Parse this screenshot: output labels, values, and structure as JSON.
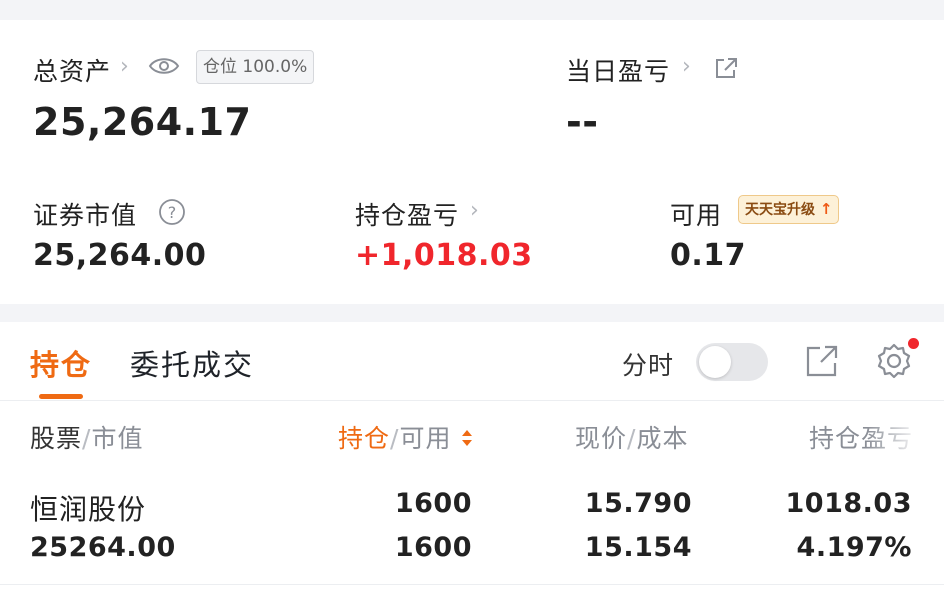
{
  "summary": {
    "total_assets_label": "总资产",
    "position_badge": "仓位 100.0%",
    "total_assets_value": "25,264.17",
    "daily_pnl_label": "当日盈亏",
    "daily_pnl_value": "--",
    "market_value_label": "证券市值",
    "market_value_value": "25,264.00",
    "holding_pnl_label": "持仓盈亏",
    "holding_pnl_value": "+1,018.03",
    "available_label": "可用",
    "available_value": "0.17",
    "promo_label": "天天宝升级"
  },
  "tabs": {
    "holdings": "持仓",
    "orders": "委托成交"
  },
  "toolbar": {
    "timeshare_label": "分时",
    "timeshare_on": false
  },
  "table": {
    "col1_a": "股票",
    "col1_b": "市值",
    "col2_a": "持仓",
    "col2_b": "可用",
    "col3_a": "现价",
    "col3_b": "成本",
    "col4": "持仓盈亏",
    "separator": "/",
    "rows": [
      {
        "name": "恒润股份",
        "market_value": "25264.00",
        "position": "1600",
        "available": "1600",
        "price": "15.790",
        "cost": "15.154",
        "pnl": "1018.03",
        "pnl_pct": "4.197%"
      }
    ]
  },
  "icons": [
    "chevron-right-icon",
    "eye-icon",
    "external-link-icon",
    "help-icon",
    "up-arrow-icon",
    "share-icon",
    "gear-icon",
    "sort-icon"
  ],
  "colors": {
    "accent": "#ef6a13",
    "profit_red": "#f0262c",
    "notify_dot": "#f0262c"
  }
}
